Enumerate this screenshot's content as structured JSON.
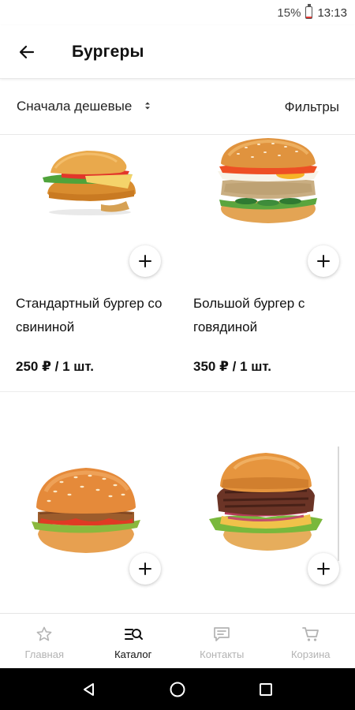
{
  "status_bar": {
    "battery": "15%",
    "battery_level": 0.15,
    "time": "13:13"
  },
  "header": {
    "title": "Бургеры"
  },
  "toolbar": {
    "sort_label": "Сначала дешевые",
    "filters_label": "Фильтры"
  },
  "products": [
    {
      "name": "Стандартный бургер со свининой",
      "price": "250 ₽ / 1 шт."
    },
    {
      "name": "Большой бургер с говядиной",
      "price": "350 ₽ / 1 шт."
    }
  ],
  "bottom_nav": {
    "items": [
      {
        "label": "Главная",
        "icon": "star-icon",
        "active": false
      },
      {
        "label": "Каталог",
        "icon": "catalog-search-icon",
        "active": true
      },
      {
        "label": "Контакты",
        "icon": "chat-icon",
        "active": false
      },
      {
        "label": "Корзина",
        "icon": "cart-icon",
        "active": false
      }
    ]
  },
  "colors": {
    "accent_text": "#111111",
    "inactive_nav": "#b3b3b3",
    "battery_low": "#e53935"
  }
}
